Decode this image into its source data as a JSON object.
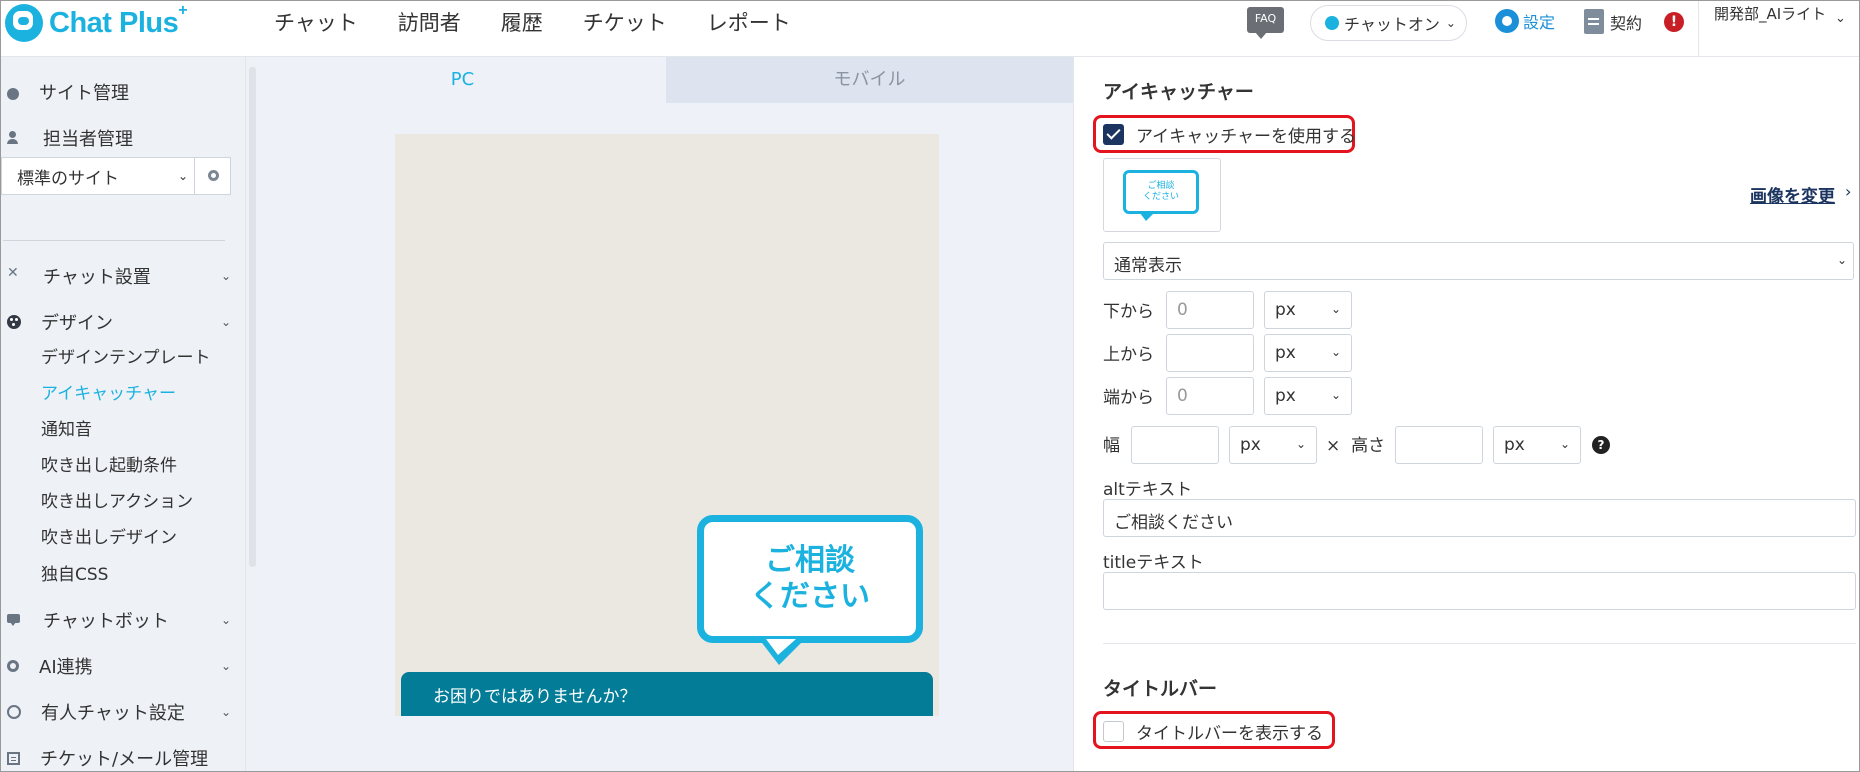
{
  "app": {
    "logo_text": "Chat Plus",
    "logo_sup": "+"
  },
  "header": {
    "nav": [
      {
        "label": "チャット"
      },
      {
        "label": "訪問者"
      },
      {
        "label": "履歴"
      },
      {
        "label": "チケット"
      },
      {
        "label": "レポート"
      }
    ],
    "faq_label": "FAQ",
    "status_label": "チャットオン",
    "settings_label": "設定",
    "contract_label": "契約",
    "alert_glyph": "!",
    "user_label": "開発部_AIライト"
  },
  "sidebar": {
    "top_items": [
      {
        "label": "サイト管理",
        "icon": "site-gear-icon"
      },
      {
        "label": "担当者管理",
        "icon": "user-icon"
      }
    ],
    "site_select_value": "標準のサイト",
    "sections": [
      {
        "label": "チャット設置",
        "icon": "tools-icon"
      },
      {
        "label": "デザイン",
        "icon": "palette-icon"
      }
    ],
    "design_subitems": [
      {
        "label": "デザインテンプレート",
        "active": false
      },
      {
        "label": "アイキャッチャー",
        "active": true
      },
      {
        "label": "通知音",
        "active": false
      },
      {
        "label": "吹き出し起動条件",
        "active": false
      },
      {
        "label": "吹き出しアクション",
        "active": false
      },
      {
        "label": "吹き出しデザイン",
        "active": false
      },
      {
        "label": "独自CSS",
        "active": false
      }
    ],
    "bottom_sections": [
      {
        "label": "チャットボット",
        "icon": "chatbot-icon"
      },
      {
        "label": "AI連携",
        "icon": "ai-icon"
      },
      {
        "label": "有人チャット設定",
        "icon": "headset-icon"
      },
      {
        "label": "チケット/メール管理",
        "icon": "ticket-icon"
      }
    ]
  },
  "preview": {
    "tabs": [
      {
        "label": "PC",
        "active": true
      },
      {
        "label": "モバイル",
        "active": false
      }
    ],
    "eyecatcher_line1": "ご相談",
    "eyecatcher_line2": "ください",
    "chat_bar_text": "お困りではありませんか？"
  },
  "settings": {
    "eyecatcher_heading": "アイキャッチャー",
    "use_eyecatcher_label": "アイキャッチャーを使用する",
    "use_eyecatcher_checked": true,
    "thumb_line1": "ご相談",
    "thumb_line2": "ください",
    "change_image_label": "画像を変更",
    "display_mode": "通常表示",
    "position": {
      "bottom_label": "下から",
      "bottom_value": "",
      "bottom_placeholder": "0",
      "bottom_unit": "px",
      "top_label": "上から",
      "top_value": "",
      "top_unit": "px",
      "side_label": "端から",
      "side_value": "",
      "side_placeholder": "0",
      "side_unit": "px"
    },
    "size": {
      "width_label": "幅",
      "width_value": "",
      "width_unit": "px",
      "times": "×",
      "height_label": "高さ",
      "height_value": "",
      "height_unit": "px",
      "help_glyph": "?"
    },
    "alt_label": "altテキスト",
    "alt_value": "ご相談ください",
    "title_label": "titleテキスト",
    "title_value": "",
    "titlebar_heading": "タイトルバー",
    "show_titlebar_label": "タイトルバーを表示する",
    "show_titlebar_checked": false
  },
  "colors": {
    "brand": "#1bb2e0",
    "chat_bar": "#037c97",
    "highlight": "#e3141d",
    "checkbox_checked": "#1c3460"
  }
}
